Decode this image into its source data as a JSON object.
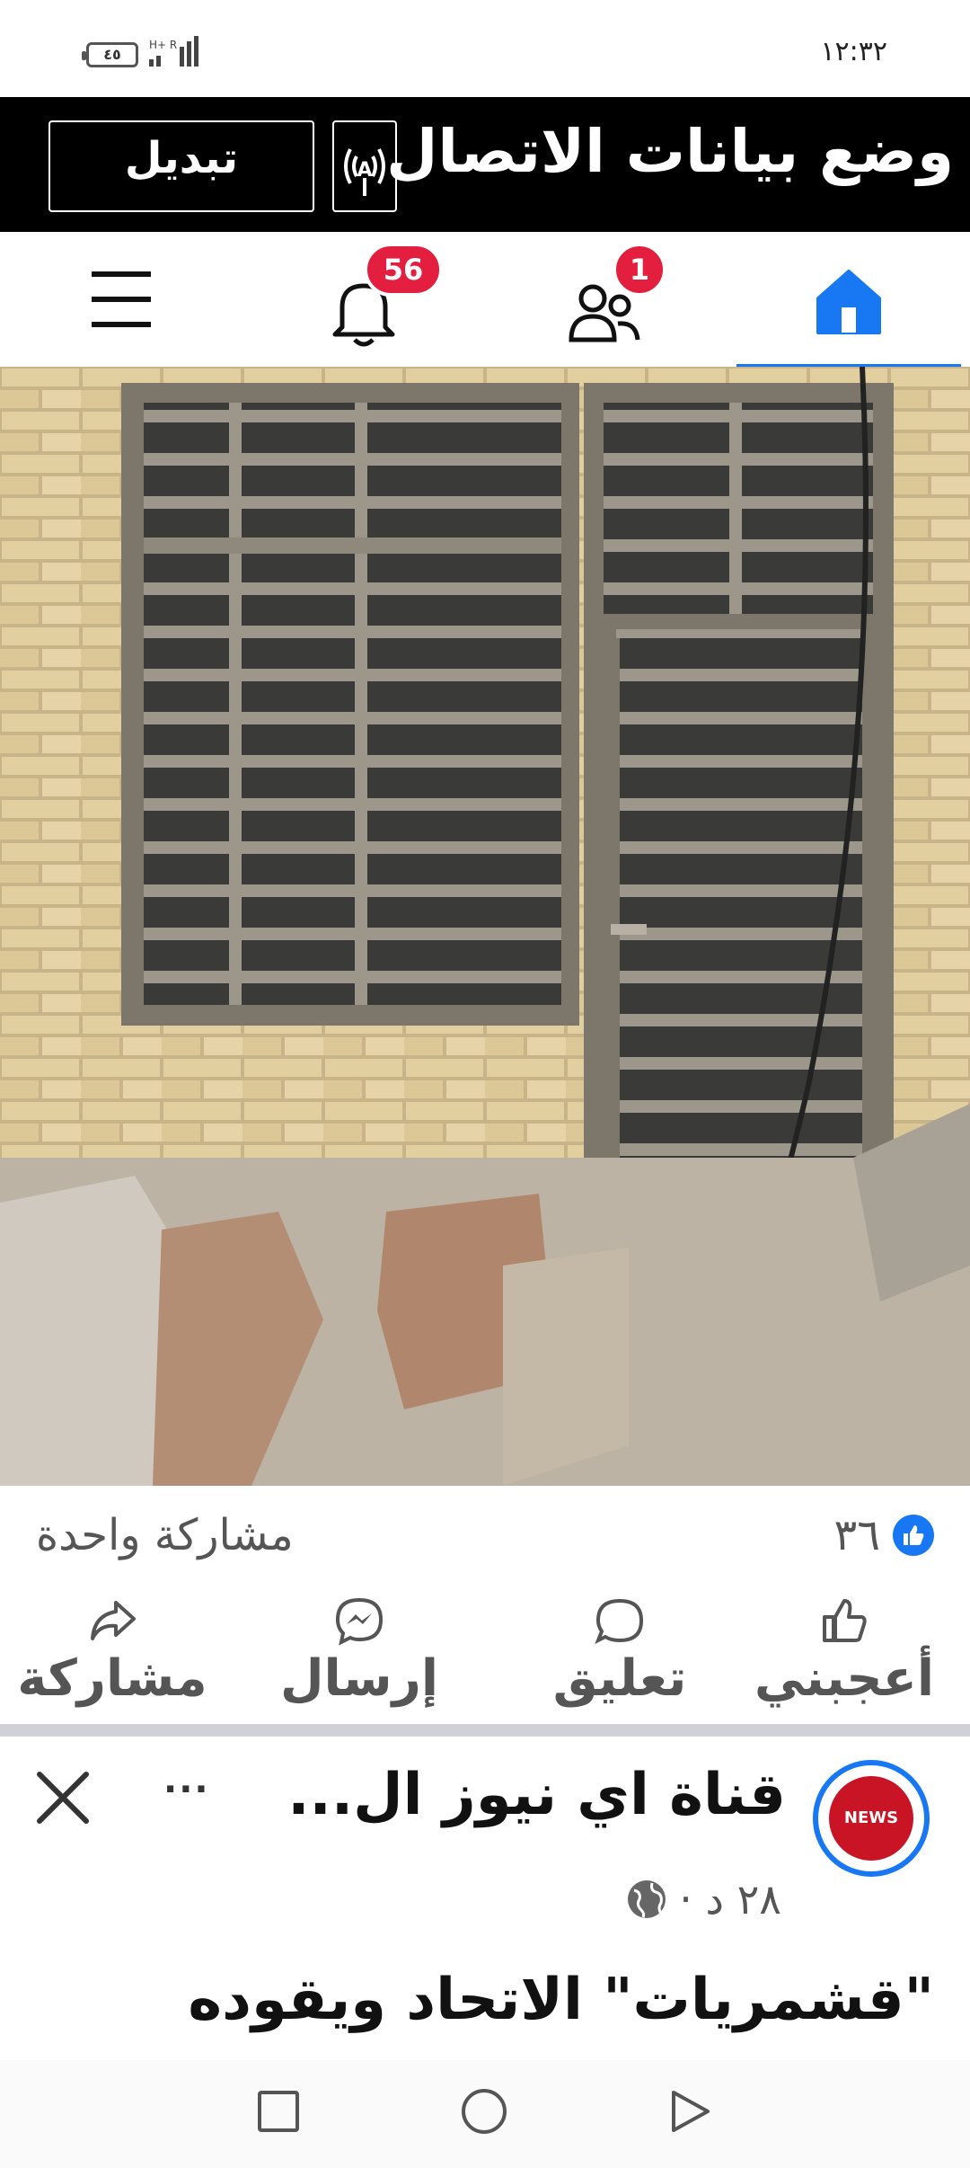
{
  "status_bar": {
    "time": "١٢:٣٢",
    "battery_label": "٤٥",
    "network": "H+ R",
    "battery_icon": "battery-icon",
    "signal_icon": "signal-icon"
  },
  "data_banner": {
    "title": "وضع بيانات الاتصال",
    "toggle_label": "تبديل",
    "icon": "broadcast-icon"
  },
  "nav": {
    "notifications_badge": "56",
    "friends_badge": "1",
    "accent_color": "#1877f2",
    "badge_color": "#e41e3f",
    "items": [
      "home-icon",
      "friends-icon",
      "bell-icon",
      "menu-icon"
    ]
  },
  "post": {
    "reactions_count": "٣٦",
    "shares": "مشاركة واحدة",
    "actions": {
      "like": "أعجبني",
      "comment": "تعليق",
      "send": "إرسال",
      "share": "مشاركة"
    }
  },
  "next_post": {
    "channel_name": "قناة اي نيوز ال...",
    "avatar_text": "NEWS",
    "time": "٢٨ د ·",
    "text": "\"قشمريات\" الاتحاد ويقوده",
    "more": "···"
  }
}
